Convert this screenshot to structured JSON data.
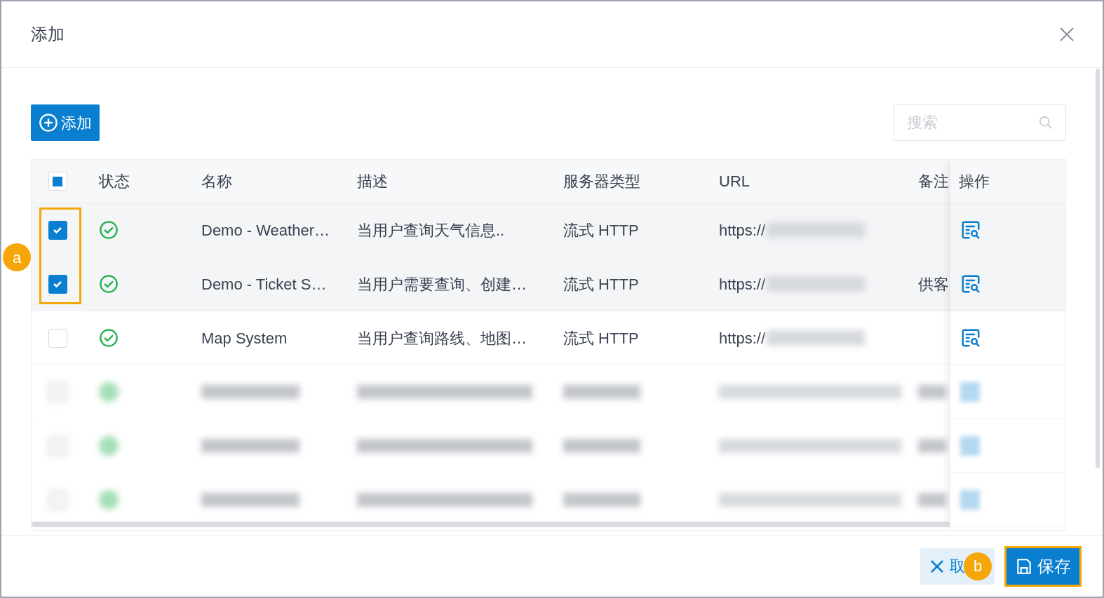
{
  "dialog": {
    "title": "添加"
  },
  "toolbar": {
    "add_button": "添加",
    "search": {
      "placeholder": "搜索"
    }
  },
  "table": {
    "select_all": {
      "indeterminate": true
    },
    "columns": [
      "状态",
      "名称",
      "描述",
      "服务器类型",
      "URL",
      "备注",
      "操作"
    ],
    "rows": [
      {
        "kind": "row",
        "checked": true,
        "active": true,
        "name": "Demo - Weather…",
        "description": "当用户查询天气信息..",
        "type": "流式 HTTP",
        "url": "https://"
      },
      {
        "kind": "row",
        "checked": true,
        "active": true,
        "name": "Demo - Ticket S…",
        "description": "当用户需要查询、创建…",
        "type": "流式 HTTP",
        "url": "https://",
        "note": "供客"
      },
      {
        "kind": "row",
        "checked": false,
        "active": true,
        "name": "Map System",
        "description": "当用户查询路线、地图…",
        "type": "流式 HTTP",
        "url": "https://"
      },
      {
        "kind": "blurred",
        "checked": false
      },
      {
        "kind": "blurred",
        "checked": false
      },
      {
        "kind": "blurred",
        "checked": false
      }
    ]
  },
  "footer": {
    "cancel_button": "取",
    "save_button": "保存"
  },
  "markers": [
    {
      "label": "a"
    },
    {
      "label": "b"
    }
  ]
}
